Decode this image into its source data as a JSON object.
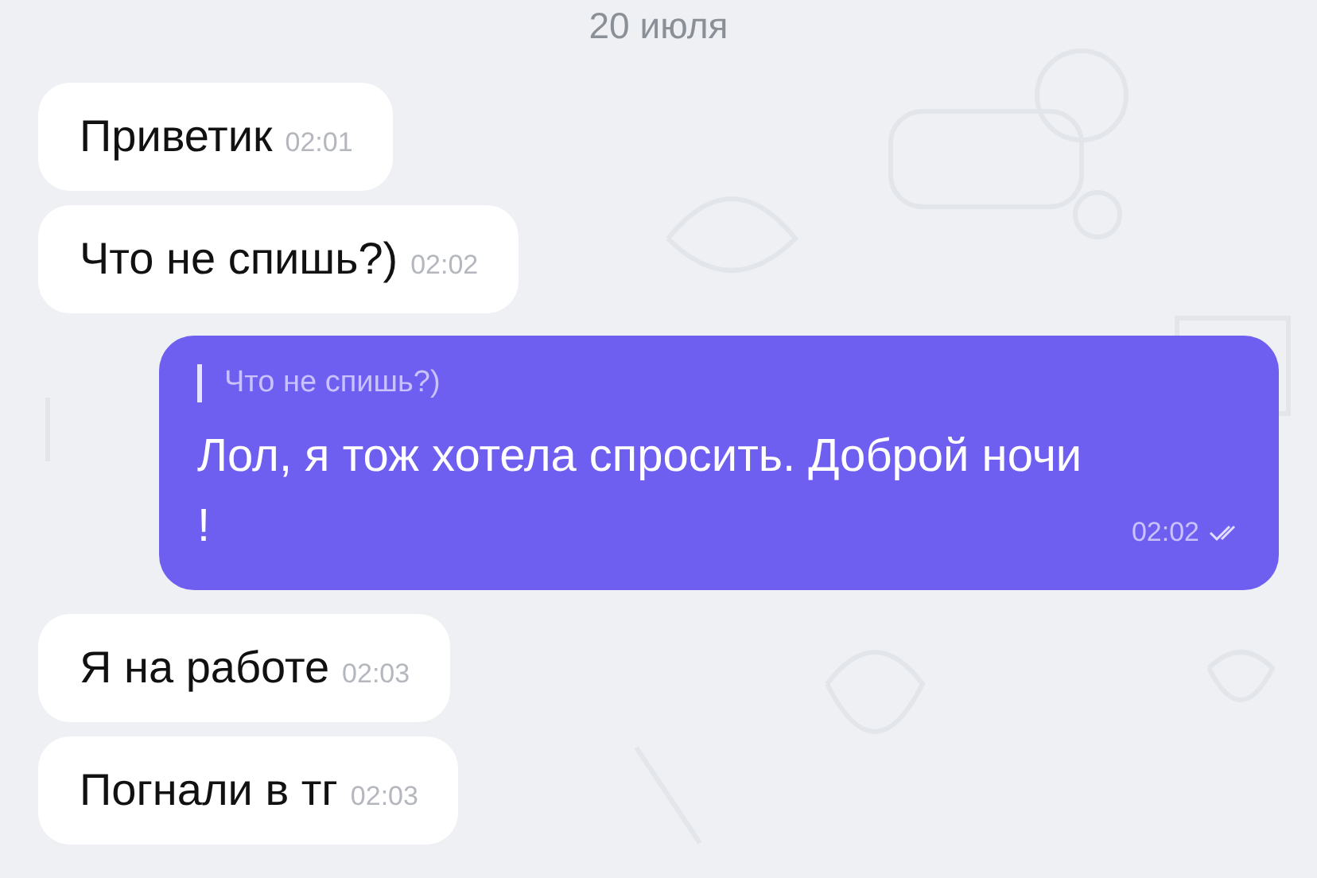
{
  "date": "20 июля",
  "messages": [
    {
      "kind": "incoming",
      "text": "Приветик",
      "time": "02:01"
    },
    {
      "kind": "incoming",
      "text": "Что не спишь?)",
      "time": "02:02"
    },
    {
      "kind": "outgoing",
      "reply_to": "Что не спишь?)",
      "text": "Лол, я тож хотела спросить. Доброй ночи !",
      "time": "02:02",
      "read": true
    },
    {
      "kind": "incoming",
      "text": "Я на работе",
      "time": "02:03"
    },
    {
      "kind": "incoming",
      "text": "Погнали в тг",
      "time": "02:03"
    }
  ]
}
